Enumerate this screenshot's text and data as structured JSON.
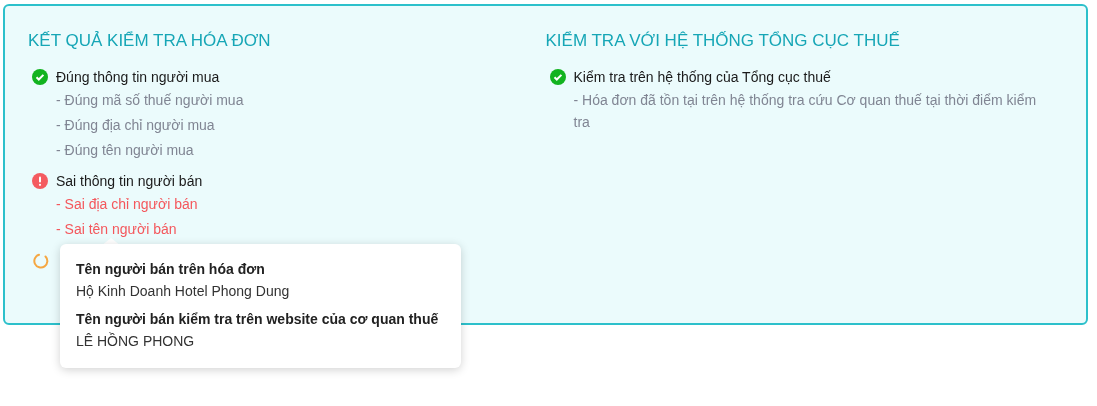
{
  "sections": [
    {
      "title": "KẾT QUẢ KIỂM TRA HÓA ĐƠN",
      "items": [
        {
          "kind": "ok",
          "label": "Đúng thông tin người mua",
          "details": [
            "- Đúng mã số thuế người mua",
            "- Đúng địa chỉ người mua",
            "- Đúng tên người mua"
          ]
        },
        {
          "kind": "error",
          "label": "Sai thông tin người bán",
          "details": [
            "- Sai địa chỉ người bán",
            "- Sai tên người bán"
          ]
        },
        {
          "kind": "loading"
        }
      ]
    },
    {
      "title": "KIỂM TRA VỚI HỆ THỐNG TỔNG CỤC THUẾ",
      "items": [
        {
          "kind": "ok",
          "label": "Kiểm tra trên hệ thống của Tổng cục thuế",
          "details": [
            "- Hóa đơn đã tồn tại trên hệ thống tra cứu Cơ quan thuế tại thời điểm kiểm tra"
          ]
        }
      ]
    }
  ],
  "tooltip": {
    "entries": [
      {
        "label": "Tên người bán trên hóa đơn",
        "value": "Hộ Kinh Doanh Hotel Phong Dung"
      },
      {
        "label": "Tên người bán kiểm tra trên website của cơ quan thuế",
        "value": "LÊ HỒNG PHONG"
      }
    ]
  }
}
